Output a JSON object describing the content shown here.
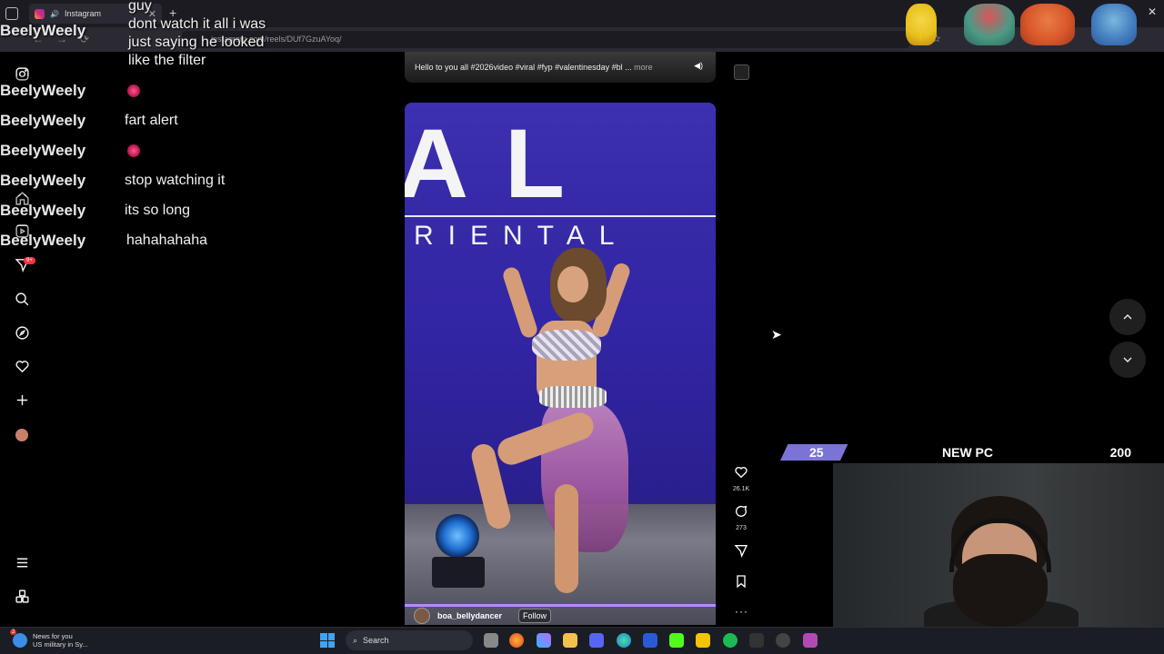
{
  "browser": {
    "tab_title": "Instagram",
    "url": "instagram.com/reels/DUf7GzuAYoq/",
    "tab_close": "✕",
    "new_tab": "+",
    "win_controls": [
      "—",
      "✕"
    ]
  },
  "chat": {
    "top_user": "BeelyWeely",
    "top_message_lines": [
      "guy",
      "dont watch it all i was",
      "just saying he looked",
      "like the filter"
    ],
    "rows": [
      {
        "user": "BeelyWeely",
        "message": "",
        "emote": "heart-emote"
      },
      {
        "user": "BeelyWeely",
        "message": "fart alert",
        "emote": ""
      },
      {
        "user": "BeelyWeely",
        "message": "",
        "emote": "heart-emote"
      },
      {
        "user": "BeelyWeely",
        "message": "stop watching it",
        "emote": ""
      },
      {
        "user": "BeelyWeely",
        "message": "its so long",
        "emote": ""
      },
      {
        "user": "BeelyWeely",
        "message": "hahahahaha",
        "emote": ""
      }
    ]
  },
  "instagram": {
    "notification_badge": "9+",
    "previous_reel_caption": "Hello to you all #2026video #viral #fyp #valentinesday #bl ...",
    "previous_reel_more": "more",
    "reel": {
      "sign_text": "AL",
      "sign_subtext": "RIENTAL",
      "author": "boa_bellydancer",
      "follow_label": "Follow",
      "likes": "26.1K",
      "comments": "273"
    }
  },
  "goal": {
    "current": "25",
    "title": "NEW PC",
    "target": "200",
    "progress_fraction": 0.125,
    "fill_color": "#7b74d6"
  },
  "taskbar": {
    "news_title": "News for you",
    "news_subtitle": "US military in Sy...",
    "news_badge": "2",
    "search_label": "Search"
  }
}
